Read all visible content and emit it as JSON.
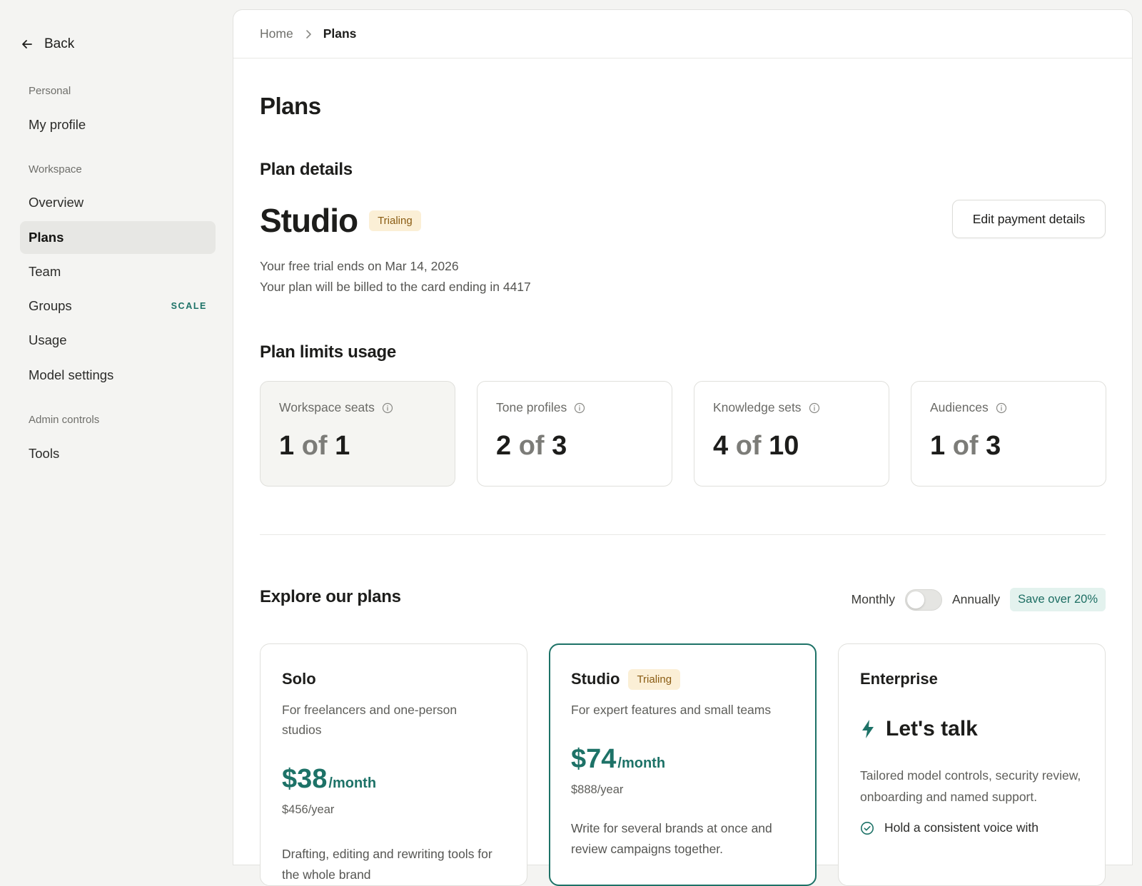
{
  "sidebar": {
    "back_label": "Back",
    "sections": {
      "personal": "Personal",
      "workspace": "Workspace",
      "admin": "Admin controls"
    },
    "items": {
      "my_profile": "My profile",
      "overview": "Overview",
      "plans": "Plans",
      "team": "Team",
      "groups": "Groups",
      "groups_tag": "SCALE",
      "usage": "Usage",
      "model_settings": "Model settings",
      "tools": "Tools"
    },
    "active_item": "plans"
  },
  "breadcrumb": {
    "home": "Home",
    "current": "Plans"
  },
  "page": {
    "title": "Plans",
    "plan_details": {
      "heading": "Plan details",
      "plan_name": "Studio",
      "status_badge": "Trialing",
      "trial_line": "Your free trial ends on Mar 14, 2026",
      "billing_line": "Your plan will be billed to the card ending in 4417",
      "edit_button": "Edit payment details"
    },
    "limits": {
      "heading": "Plan limits usage",
      "of_word": "of",
      "items": [
        {
          "label": "Workspace seats",
          "used": "1",
          "total": "1"
        },
        {
          "label": "Tone profiles",
          "used": "2",
          "total": "3"
        },
        {
          "label": "Knowledge sets",
          "used": "4",
          "total": "10"
        },
        {
          "label": "Audiences",
          "used": "1",
          "total": "3"
        }
      ]
    },
    "explore": {
      "heading": "Explore our plans",
      "monthly_label": "Monthly",
      "annually_label": "Annually",
      "save_badge": "Save over 20%",
      "toggle_annual_on": false,
      "plans": {
        "solo": {
          "title": "Solo",
          "description": "For freelancers and one-person studios",
          "price": "$38",
          "per": "/month",
          "yearly": "$456/year",
          "feature": "Drafting, editing and rewriting tools for the whole brand"
        },
        "studio": {
          "title": "Studio",
          "badge": "Trialing",
          "description": "For expert features and small teams",
          "price": "$74",
          "per": "/month",
          "yearly": "$888/year",
          "feature": "Write for several brands at once and review campaigns together."
        },
        "enterprise": {
          "title": "Enterprise",
          "cta": "Let's talk",
          "description": "Tailored model controls, security review, onboarding and named support.",
          "check_item": "Hold a consistent voice with"
        }
      }
    }
  },
  "colors": {
    "accent": "#1d7267",
    "trial_badge_bg": "#fbefd6",
    "trial_badge_text": "#8a5c13"
  }
}
